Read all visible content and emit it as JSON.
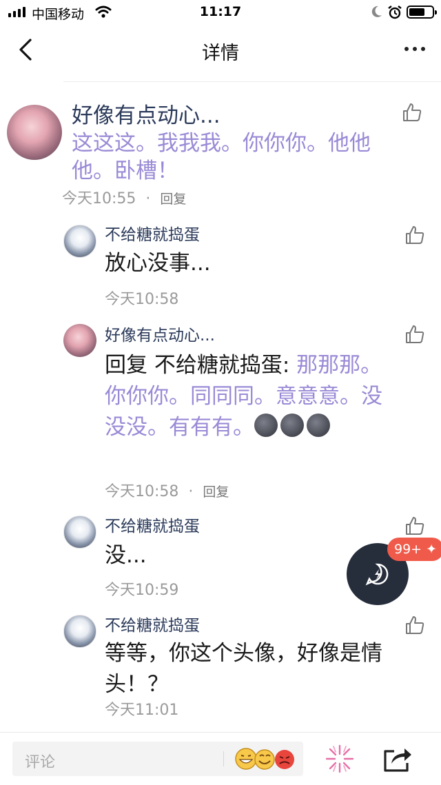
{
  "status_bar": {
    "carrier": "中国移动",
    "time": "11:17"
  },
  "nav": {
    "title": "详情"
  },
  "main_comment": {
    "name": "好像有点动心...",
    "text_purple": "这这这。我我我。你你你。他他他。卧槽！",
    "time": "今天10:55",
    "reply_label": "回复"
  },
  "replies": [
    {
      "name": "不给糖就捣蛋",
      "text": "放心没事...",
      "time": "今天10:58"
    },
    {
      "name": "好像有点动心...",
      "prefix": "回复 不给糖就捣蛋: ",
      "text_purple": "那那那。你你你。同同同。意意意。没没没。有有有。",
      "emoji": "new-moon-face",
      "time": "今天10:58",
      "reply_label": "回复"
    },
    {
      "name": "不给糖就捣蛋",
      "text": "没...",
      "time": "今天10:59"
    },
    {
      "name": "不给糖就捣蛋",
      "text": "等等，你这个头像，好像是情头！？",
      "time": "今天11:01"
    }
  ],
  "floating": {
    "badge": "99+"
  },
  "bottom_bar": {
    "comment_placeholder": "评论"
  },
  "colors": {
    "purple": "#9a8ad6",
    "name": "#2b3a5a",
    "badge": "#f05a4a",
    "fab": "#262d3b"
  }
}
